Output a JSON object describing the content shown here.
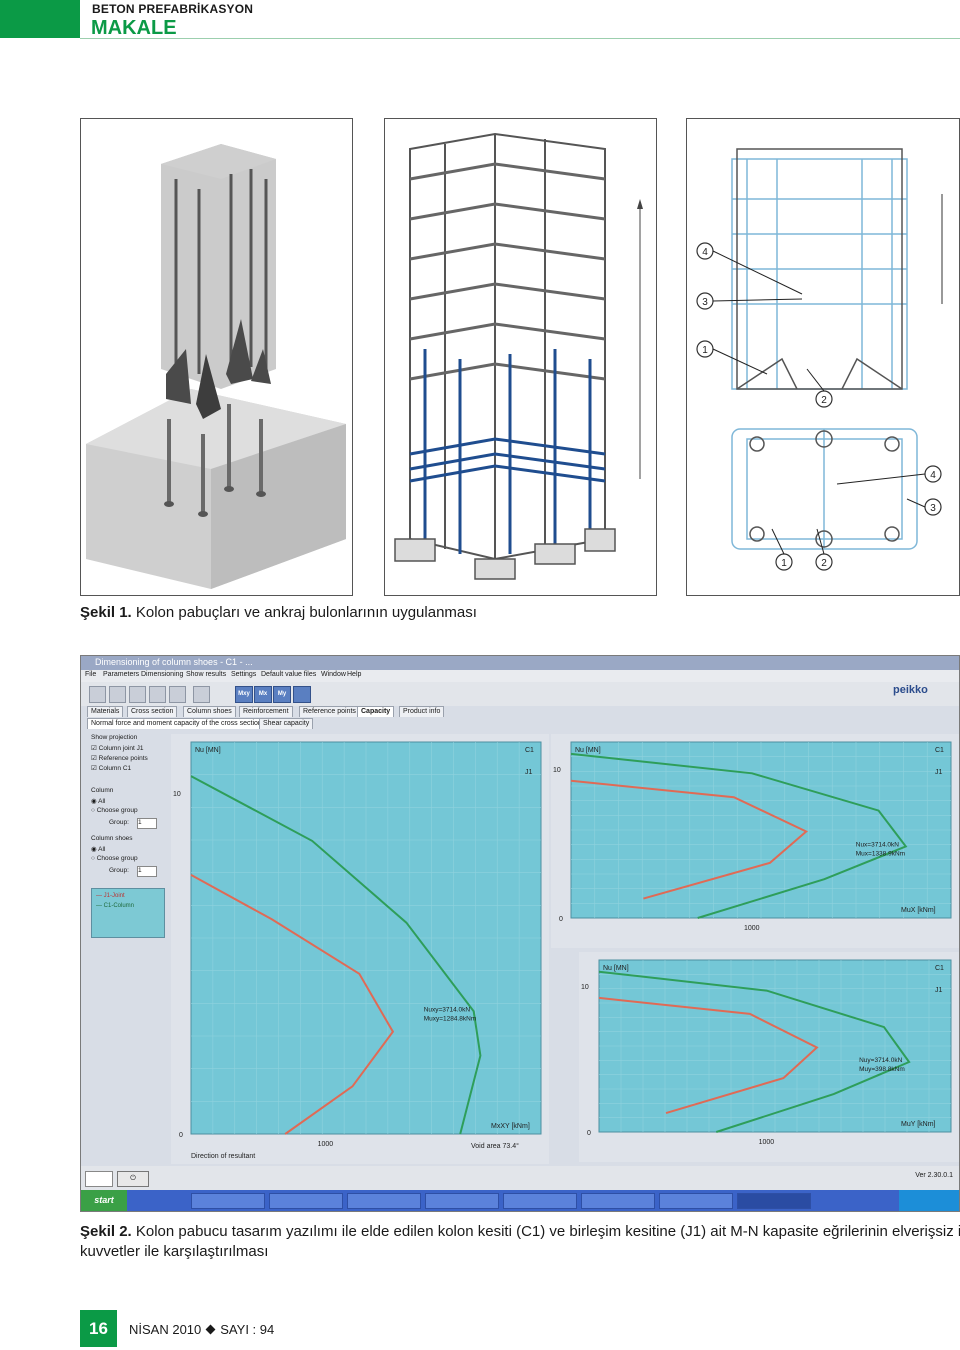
{
  "header": {
    "section": "BETON PREFABRİKASYON",
    "category": "MAKALE"
  },
  "figure1": {
    "label": "Şekil 1.",
    "text": "Kolon pabuçları ve ankraj bulonlarının uygulanması",
    "callouts": [
      "4",
      "3",
      "1",
      "2",
      "4",
      "3",
      "1",
      "2"
    ]
  },
  "figure2": {
    "label": "Şekil 2.",
    "text": "Kolon pabucu tasarım yazılımı ile elde edilen kolon kesiti (C1) ve birleşim kesitine (J1) ait M-N kapasite eğrilerinin elverişsiz iç",
    "text_line2": "kuvvetler ile karşılaştırılması"
  },
  "software": {
    "title": "Dimensioning of column shoes - C1 - ...",
    "brand": "peikko",
    "menu": [
      "File",
      "Parameters",
      "Dimensioning",
      "Show results",
      "Settings",
      "Default value files",
      "Window",
      "Help"
    ],
    "toolbar_buttons": [
      "Mxy",
      "Mx",
      "My"
    ],
    "tabs": [
      "Materials",
      "Cross section",
      "Column shoes",
      "Reinforcement",
      "Reference points",
      "Capacity",
      "Product info"
    ],
    "subtabs": [
      "Normal force and moment capacity of the cross section",
      "Shear capacity"
    ],
    "side_panel": {
      "show_projection": "Show projection",
      "checks": [
        "Column joint J1",
        "Reference points",
        "Column C1"
      ],
      "column_title": "Column",
      "column_opts": [
        "All",
        "Choose group"
      ],
      "group_label": "Group:",
      "group_value": "1",
      "shoes_title": "Column shoes",
      "shoes_opts": [
        "All",
        "Choose group"
      ],
      "legend": [
        "J1-Joint",
        "C1-Column"
      ]
    },
    "direction_label": "Direction of resultant",
    "void_area": "Void area 73.4°",
    "version": "Ver 2.30.0.1",
    "colors": {
      "joint_curve": "#e06a55",
      "column_curve": "#2e9e5a",
      "plot_bg": "#74c7d6",
      "grid": "#8fd2de"
    }
  },
  "chart_data": [
    {
      "type": "line",
      "title": "",
      "xlabel": "MxXY [kNm]",
      "ylabel": "Nu [MN]",
      "series": [
        {
          "name": "C1",
          "points": [
            [
              0,
              10.5
            ],
            [
              900,
              8.6
            ],
            [
              1600,
              6.2
            ],
            [
              2100,
              3.6
            ],
            [
              2150,
              2.3
            ],
            [
              2000,
              0
            ]
          ]
        },
        {
          "name": "J1",
          "points": [
            [
              0,
              7.6
            ],
            [
              600,
              6.3
            ],
            [
              1250,
              4.7
            ],
            [
              1500,
              3.0
            ],
            [
              1200,
              1.4
            ],
            [
              700,
              0
            ]
          ]
        }
      ],
      "x_ticks": [
        "1000"
      ],
      "y_ticks": [
        "10",
        "0"
      ],
      "annotation": [
        "Nuxy=3714.0kN",
        "Muxy=1284.8kNm"
      ]
    },
    {
      "type": "line",
      "title": "",
      "xlabel": "MuX [kNm]",
      "ylabel": "Nu [MN]",
      "series": [
        {
          "name": "C1",
          "points": [
            [
              0,
              11
            ],
            [
              1000,
              9.7
            ],
            [
              1700,
              7.2
            ],
            [
              1850,
              4.8
            ],
            [
              1400,
              2.6
            ],
            [
              700,
              0
            ]
          ]
        },
        {
          "name": "J1",
          "points": [
            [
              0,
              9.2
            ],
            [
              900,
              8.1
            ],
            [
              1300,
              5.8
            ],
            [
              1100,
              3.7
            ],
            [
              400,
              1.3
            ]
          ]
        }
      ],
      "x_ticks": [
        "1000"
      ],
      "y_ticks": [
        "10",
        "0"
      ],
      "annotation": [
        "Nux=3714.0kN",
        "Mux=1338.9kNm"
      ]
    },
    {
      "type": "line",
      "title": "",
      "xlabel": "MuY [kNm]",
      "ylabel": "Nu [MN]",
      "series": [
        {
          "name": "C1",
          "points": [
            [
              0,
              11
            ],
            [
              1000,
              9.7
            ],
            [
              1700,
              7.2
            ],
            [
              1850,
              4.8
            ],
            [
              1400,
              2.6
            ],
            [
              700,
              0
            ]
          ]
        },
        {
          "name": "J1",
          "points": [
            [
              0,
              9.2
            ],
            [
              900,
              8.1
            ],
            [
              1300,
              5.8
            ],
            [
              1100,
              3.7
            ],
            [
              400,
              1.3
            ]
          ]
        }
      ],
      "x_ticks": [
        "1000"
      ],
      "y_ticks": [
        "10",
        "0"
      ],
      "annotation": [
        "Nuy=3714.0kN",
        "Muy=398.8kNm"
      ]
    }
  ],
  "footer": {
    "page": "16",
    "issue_date": "NİSAN 2010",
    "issue_no": "SAYI : 94"
  }
}
